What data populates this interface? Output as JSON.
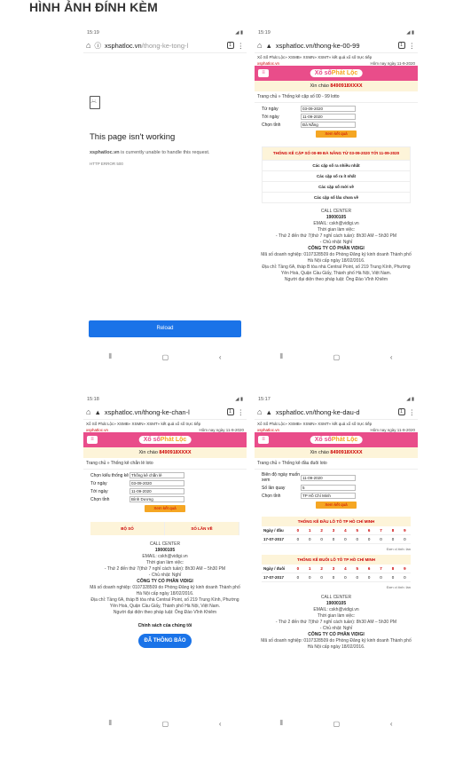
{
  "heading": "HÌNH ẢNH ĐÍNH KÈM",
  "p1": {
    "time": "15:19",
    "url_host": "xsphatloc.vn",
    "url_path": "/thong-ke-tong-l",
    "title": "This page isn't working",
    "message_host": "xsphatloc.vn",
    "message_rest": " is currently unable to handle this request.",
    "code": "HTTP ERROR 500",
    "reload": "Reload"
  },
  "common": {
    "site_header": "Xổ Số Phát Lộc» XSMB» XSMN» XSMT» kết quả xổ số trực tiếp",
    "site_url": "xsphatloc.vn",
    "logo_main": "Xổ số",
    "logo_sub": "Phát Lộc",
    "greeting_prefix": "Xin chào ",
    "greeting_number": "8490918XXXX",
    "search_button": "Xem kết quả",
    "call_center": "CALL CENTER",
    "phone": "19000105",
    "email": "EMAIL: cskh@vidigi.vn",
    "work_time_label": "Thời gian làm việc:",
    "work_time": "- Thứ 2 đến thứ 7(thứ 7 nghỉ cách tuần): 8h30 AM – 5h30 PM",
    "sunday": "- Chủ nhật: Nghỉ",
    "company": "CÔNG TY CỔ PHẦN VIDIGI",
    "license": "Mã số doanh nghiệp: 0107328509 do Phòng Đăng ký kinh doanh Thành phố Hà Nội cấp ngày 18/02/2016.",
    "address": "Địa chỉ: Tầng 6A, tháp B tòa nhà Central Point, số 219 Trung Kính, Phường Yên Hoà, Quận Cầu Giấy, Thành phố Hà Nội, Việt Nam.",
    "rep": "Người đại diện theo pháp luật: Ông Đào Vĩnh Khiêm"
  },
  "p2": {
    "time": "15:19",
    "url": "xsphatloc.vn/thong-ke-00-99",
    "date_line": "Hôm nay ngày 11-9-2020",
    "crumb": "Trang chủ » Thống kê cặp số 00 - 99 lotto",
    "fields": [
      {
        "label": "Từ ngày",
        "value": "03-09-2020"
      },
      {
        "label": "Tới ngày",
        "value": "11-09-2020"
      },
      {
        "label": "Chọn tỉnh",
        "value": "Đà Nẵng"
      }
    ],
    "box_title": "THỐNG KÊ CẶP SỐ 00-99 ĐÀ NẴNG TỪ 03-09-2020 TỚI 11-09-2020",
    "items": [
      "Các cặp số ra nhiều nhất",
      "Các cặp số ra ít nhất",
      "Các cặp số mới về",
      "Các cặp số lâu chưa về"
    ]
  },
  "p3": {
    "time": "15:18",
    "url": "xsphatloc.vn/thong-ke-chan-l",
    "date_line": "Hôm nay ngày 11-9-2020",
    "crumb": "Trang chủ » Thống kê chẵn lẻ loto",
    "fields": [
      {
        "label": "Chọn kiểu thống kê",
        "value": "Thống kê chẵn lẻ"
      },
      {
        "label": "Từ ngày",
        "value": "03-09-2020"
      },
      {
        "label": "Tới ngày",
        "value": "11-09-2020"
      },
      {
        "label": "Chọn tỉnh",
        "value": "Bình Dương"
      }
    ],
    "col1": "BỘ SỐ",
    "col2": "SỐ LẦN VỀ",
    "policy": "Chính sách của chúng tôi",
    "badge": "ĐÃ THÔNG BÁO"
  },
  "p4": {
    "time": "15:17",
    "url": "xsphatloc.vn/thong-ke-dau-d",
    "date_line": "Hôm nay ngày 11-9-2020",
    "crumb": "Trang chủ » Thống kê đầu đuôi loto",
    "fields": [
      {
        "label": "Biên độ ngày muốn xem",
        "value": "11-09-2020"
      },
      {
        "label": "Số lần quay",
        "value": "5"
      },
      {
        "label": "Chọn tỉnh",
        "value": "TP Hồ Chí Minh"
      }
    ],
    "t1_title": "THỐNG KÊ ĐẦU LÔ TÔ TP HỒ CHÍ MINH",
    "t1_head": "Ngày / đầu",
    "t2_title": "THỐNG KÊ ĐUÔI LÔ TÔ TP HỒ CHÍ MINH",
    "t2_head": "Ngày / đuôi",
    "row_date": "17-07-2017",
    "digits": [
      "0",
      "1",
      "2",
      "3",
      "4",
      "5",
      "6",
      "7",
      "8",
      "9"
    ],
    "zeros": [
      "0",
      "0",
      "0",
      "0",
      "0",
      "0",
      "0",
      "0",
      "0",
      "0"
    ],
    "unit": "Đơn vị tính: lần"
  }
}
